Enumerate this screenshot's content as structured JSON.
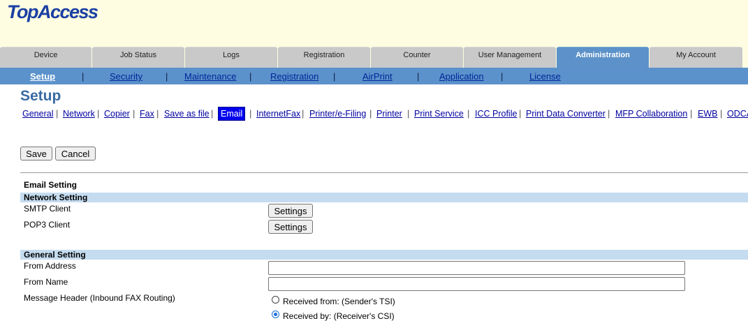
{
  "app": {
    "logo": "TopAccess"
  },
  "tabs": [
    "Device",
    "Job Status",
    "Logs",
    "Registration",
    "Counter",
    "User Management",
    "Administration",
    "My Account"
  ],
  "subnav": [
    "Setup",
    "Security",
    "Maintenance",
    "Registration",
    "AirPrint",
    "Application",
    "License"
  ],
  "subnav_separator": "|",
  "page_title": "Setup",
  "setup_tabs": [
    "General",
    "Network",
    "Copier",
    "Fax",
    "Save as file",
    "Email",
    "InternetFax",
    "Printer/e-Filing",
    "Printer",
    "Print Service",
    "ICC Profile",
    "Print Data Converter",
    "MFP Collaboration",
    "EWB",
    "ODCA"
  ],
  "setup_separator": "|",
  "actions": {
    "save": "Save",
    "cancel": "Cancel"
  },
  "email_setting": {
    "title": "Email Setting",
    "network_setting": {
      "title": "Network Setting",
      "smtp_label": "SMTP Client",
      "pop3_label": "POP3 Client",
      "settings_button": "Settings"
    },
    "general_setting": {
      "title": "General Setting",
      "from_address_label": "From Address",
      "from_address_value": "",
      "from_name_label": "From Name",
      "from_name_value": "",
      "message_header_label": "Message Header (Inbound FAX Routing)",
      "options": [
        "Received from: (Sender's TSI)",
        "Received by: (Receiver's CSI)"
      ],
      "selected_option": 1
    }
  }
}
